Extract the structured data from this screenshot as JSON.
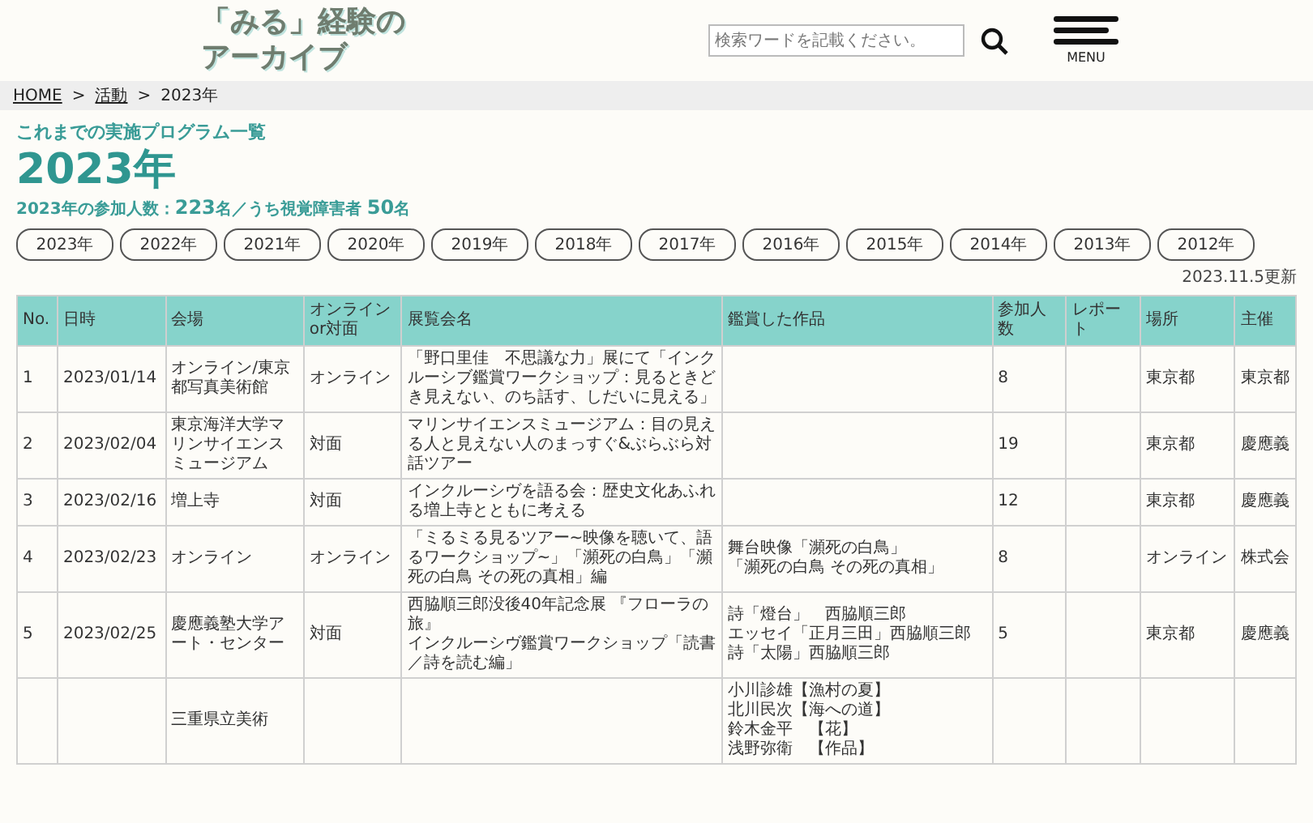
{
  "header": {
    "logo_lines": [
      "「みる」経験の",
      "アーカイブ"
    ],
    "search": {
      "placeholder": "検索ワードを記載ください。"
    },
    "menu_label": "MENU"
  },
  "breadcrumb_separator": ">",
  "breadcrumb": [
    {
      "label": "HOME",
      "kind": "link"
    },
    {
      "label": "活動",
      "kind": "link"
    },
    {
      "label": "2023年",
      "kind": "current"
    }
  ],
  "section_label": "これまでの実施プログラム一覧",
  "heading": "2023年",
  "stats": "2023年の参加人数：**223**名／うち視覚障害者 **50**名",
  "years": [
    "2023年",
    "2022年",
    "2021年",
    "2020年",
    "2019年",
    "2018年",
    "2017年",
    "2016年",
    "2015年",
    "2014年",
    "2013年",
    "2012年"
  ],
  "updated": "2023.11.5更新",
  "table": {
    "columns": [
      "No.",
      "日時",
      "会場",
      "オンライン\nor対面",
      "展覧会名",
      "鑑賞した作品",
      "参加人数",
      "レポート",
      "場所",
      "主催"
    ],
    "rows": [
      [
        "1",
        "2023/01/14",
        "オンライン/東京都写真美術館",
        "オンライン",
        "「野口里佳　不思議な力」展にて「インクルーシブ鑑賞ワークショップ：見るときどき見えない、のち話す、しだいに見える」",
        "",
        "8",
        "",
        "東京都",
        "東京都"
      ],
      [
        "2",
        "2023/02/04",
        "東京海洋大学マリンサイエンスミュージアム",
        "対面",
        "マリンサイエンスミュージアム：目の見える人と見えない人のまっすぐ&ぶらぶら対話ツアー",
        "",
        "19",
        "",
        "東京都",
        "慶應義"
      ],
      [
        "3",
        "2023/02/16",
        "増上寺",
        "対面",
        "インクルーシヴを語る会：歴史文化あふれる増上寺とともに考える",
        "",
        "12",
        "",
        "東京都",
        "慶應義"
      ],
      [
        "4",
        "2023/02/23",
        "オンライン",
        "オンライン",
        "「ミるミる見るツアー~映像を聴いて、語るワークショップ~」「瀕死の白鳥」「瀕死の白鳥 その死の真相」編",
        [
          "舞台映像「瀕死の白鳥」",
          "「瀕死の白鳥 その死の真相」"
        ],
        "8",
        "",
        "オンライン",
        "株式会"
      ],
      [
        "5",
        "2023/02/25",
        "慶應義塾大学アート・センター",
        "対面",
        [
          "西脇順三郎没後40年記念展 『フローラの旅』",
          "インクルーシヴ鑑賞ワークショップ「読書／詩を読む編」"
        ],
        [
          "詩「燈台」　西脇順三郎",
          "エッセイ「正月三田」西脇順三郎",
          "詩「太陽」西脇順三郎"
        ],
        "5",
        "",
        "東京都",
        "慶應義"
      ],
      [
        "",
        "",
        "三重県立美術",
        "",
        "",
        [
          "小川診雄【漁村の夏】",
          "北川民次【海への道】",
          "鈴木金平　【花】",
          "浅野弥衛　【作品】"
        ],
        "",
        "",
        "",
        ""
      ]
    ]
  }
}
